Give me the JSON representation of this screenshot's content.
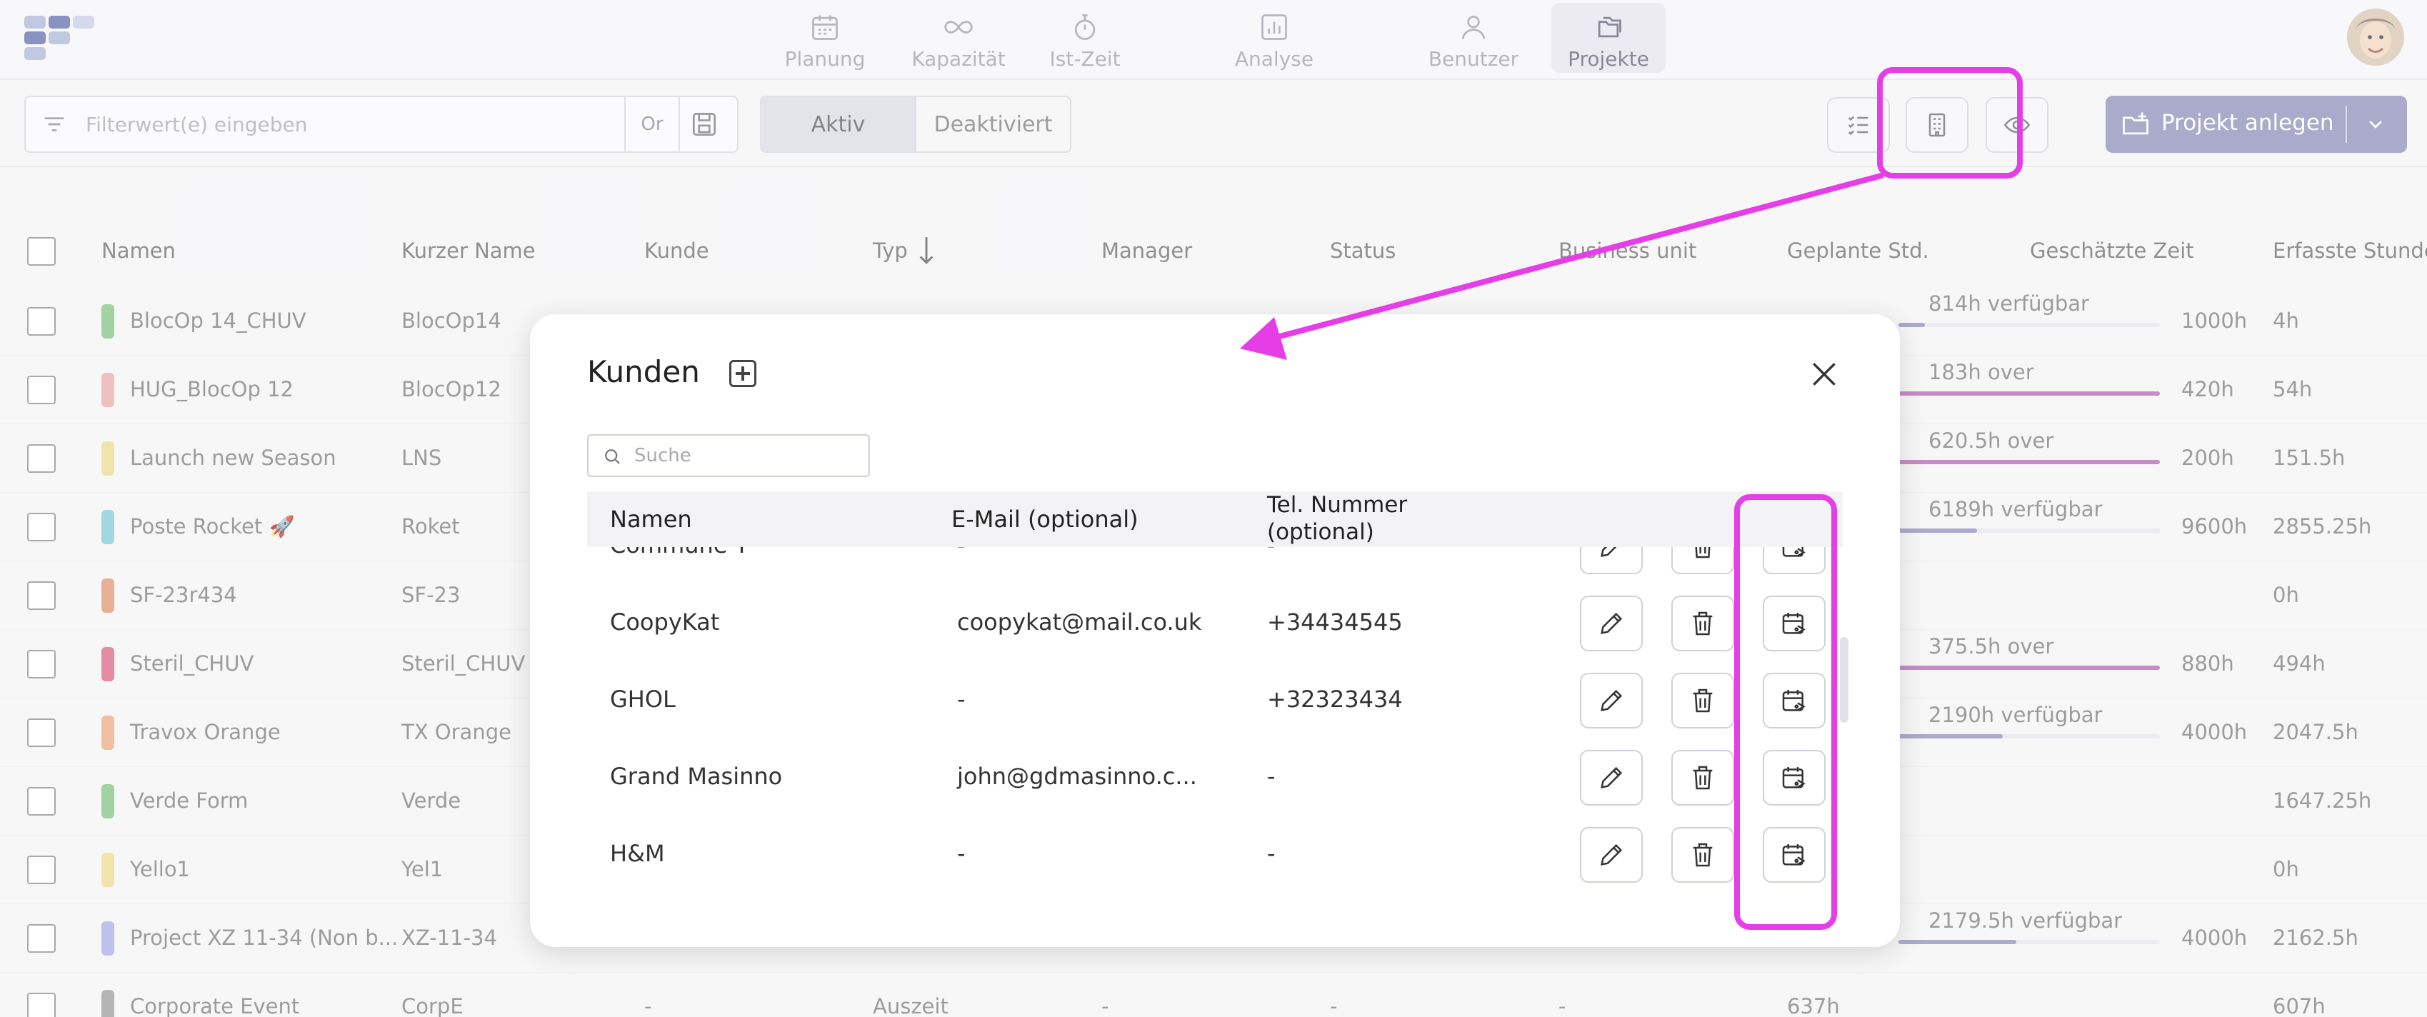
{
  "nav": {
    "items": [
      {
        "label": "Planung",
        "icon": "calendar-icon"
      },
      {
        "label": "Kapazität",
        "icon": "infinity-icon"
      },
      {
        "label": "Ist-Zeit",
        "icon": "stopwatch-icon"
      },
      {
        "label": "Analyse",
        "icon": "bar-chart-icon"
      },
      {
        "label": "Benutzer",
        "icon": "users-icon"
      },
      {
        "label": "Projekte",
        "icon": "folders-icon",
        "active": true
      }
    ]
  },
  "toolbar": {
    "filter_placeholder": "Filterwert(e) eingeben",
    "or_label": "Or",
    "segment": {
      "active": "Aktiv",
      "inactive": "Deaktiviert"
    },
    "create_label": "Projekt anlegen"
  },
  "table": {
    "columns": [
      "Namen",
      "Kurzer Name",
      "Kunde",
      "Typ",
      "Manager",
      "Status",
      "Business unit",
      "Geplante Std.",
      "Geschätzte Zeit",
      "Erfasste Stunde"
    ],
    "rows": [
      {
        "name": "BlocOp 14_CHUV",
        "short": "BlocOp14",
        "color": "#7fbf7f",
        "budget": "814h verfügbar",
        "est": "1000h",
        "rec": "4h",
        "bar_color": "#8a8ab8",
        "bar_fill": 0.1
      },
      {
        "name": "HUG_BlocOp 12",
        "short": "BlocOp12",
        "color": "#e8a8a8",
        "budget": "183h over",
        "est": "420h",
        "rec": "54h",
        "bar_color": "#b060b0",
        "bar_fill": 1.0
      },
      {
        "name": "Launch new Season",
        "short": "LNS",
        "color": "#ecd88a",
        "budget": "620.5h over",
        "est": "200h",
        "rec": "151.5h",
        "bar_color": "#b060b0",
        "bar_fill": 1.0
      },
      {
        "name": "Poste Rocket 🚀",
        "short": "Roket",
        "color": "#7ec6d6",
        "budget": "6189h verfügbar",
        "est": "9600h",
        "rec": "2855.25h",
        "bar_color": "#8a8ab8",
        "bar_fill": 0.3
      },
      {
        "name": "SF-23r434",
        "short": "SF-23",
        "color": "#e09070",
        "budget": "",
        "est": "",
        "rec": "0h",
        "bar_color": "",
        "bar_fill": 0
      },
      {
        "name": "Steril_CHUV",
        "short": "Steril_CHUV",
        "color": "#d86080",
        "budget": "375.5h over",
        "est": "880h",
        "rec": "494h",
        "bar_color": "#b060b0",
        "bar_fill": 1.0
      },
      {
        "name": "Travox Orange",
        "short": "TX Orange",
        "color": "#eca880",
        "budget": "2190h verfügbar",
        "est": "4000h",
        "rec": "2047.5h",
        "bar_color": "#8a8ab8",
        "bar_fill": 0.4
      },
      {
        "name": "Verde Form",
        "short": "Verde",
        "color": "#7fbf7f",
        "budget": "",
        "est": "",
        "rec": "1647.25h",
        "bar_color": "",
        "bar_fill": 0
      },
      {
        "name": "Yello1",
        "short": "Yel1",
        "color": "#ecd88a",
        "budget": "",
        "est": "",
        "rec": "0h",
        "bar_color": "",
        "bar_fill": 0
      },
      {
        "name": "Project XZ 11-34 (Non b...",
        "short": "XZ-11-34",
        "color": "#a8a8e8",
        "budget": "2179.5h verfügbar",
        "est": "4000h",
        "rec": "2162.5h",
        "bar_color": "#8a8ab8",
        "bar_fill": 0.45
      },
      {
        "name": "Corporate Event",
        "short": "CorpE",
        "color": "#999999",
        "budget": "",
        "est": "",
        "rec": "607h",
        "bar_color": "",
        "bar_fill": 0
      }
    ],
    "last_row_extra": {
      "kunde": "-",
      "typ": "Auszeit",
      "manager": "-",
      "status": "-",
      "bu": "-",
      "planned": "637h"
    }
  },
  "modal": {
    "title": "Kunden",
    "search_placeholder": "Suche",
    "columns": {
      "name": "Namen",
      "email": "E-Mail (optional)",
      "phone_line1": "Tel. Nummer",
      "phone_line2": "(optional)"
    },
    "rows": [
      {
        "name": "Commune Y",
        "email": "-",
        "phone": "-"
      },
      {
        "name": "CoopyKat",
        "email": "coopykat@mail.co.uk",
        "phone": "+34434545"
      },
      {
        "name": "GHOL",
        "email": "-",
        "phone": "+32323434"
      },
      {
        "name": "Grand Masinno",
        "email": "john@gdmasinno.c...",
        "phone": "-"
      },
      {
        "name": "H&M",
        "email": "-",
        "phone": "-"
      }
    ]
  },
  "colors": {
    "accent": "#8a8ab8",
    "highlight": "#e63ee6",
    "over": "#b060b0"
  }
}
